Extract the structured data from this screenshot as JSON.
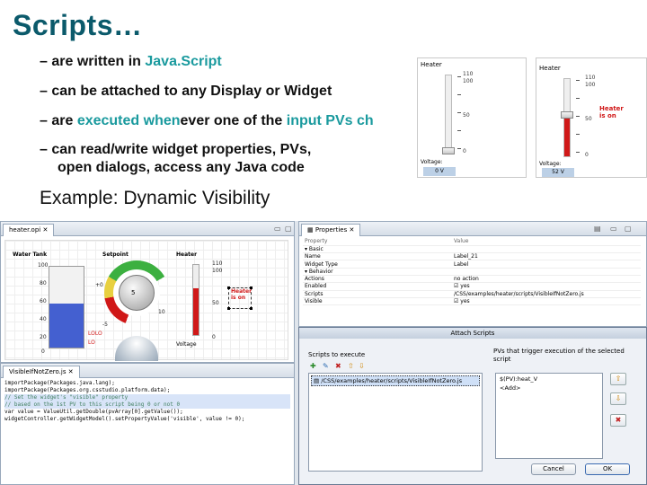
{
  "title": "Scripts…",
  "bullets": [
    {
      "pre": "– are written in ",
      "hl": "Java.Script",
      "mid": "",
      "hl2": "",
      "post": ""
    },
    {
      "pre": "– can be attached to any Display or Widget",
      "hl": "",
      "mid": "",
      "hl2": "",
      "post": ""
    },
    {
      "pre": "– are ",
      "hl": "executed when",
      "mid": "ever one of the ",
      "hl2": "input PVs ch",
      "post": ""
    },
    {
      "pre": "– can read/write widget properties, PVs,",
      "hl": "",
      "mid": "",
      "hl2": "",
      "post": ""
    },
    {
      "pre": "open dialogs, access any Java code",
      "hl": "",
      "mid": "",
      "hl2": "",
      "post": ""
    }
  ],
  "subtitle": "Example: Dynamic Visibility",
  "mini_widgets": [
    {
      "title": "Heater",
      "level": 0.0,
      "voltage_label": "Voltage:",
      "voltage_value": "0 V",
      "ticks": [
        "110",
        "100",
        "50",
        "0"
      ],
      "status": ""
    },
    {
      "title": "Heater",
      "level": 0.55,
      "voltage_label": "Voltage:",
      "voltage_value": "52 V",
      "ticks": [
        "110",
        "100",
        "50",
        "0"
      ],
      "status": "Heater is on"
    }
  ],
  "editor": {
    "tab": "heater.opi",
    "tab_close": "✕",
    "widgets": {
      "tank_label": "Water Tank",
      "tank_ticks": [
        "100",
        "80",
        "60",
        "40",
        "20",
        "0"
      ],
      "tank_level": 0.55,
      "tank_markers": [
        "LOLO",
        "LO"
      ],
      "setpoint_label": "Setpoint",
      "setpoint_value": "5",
      "setpoint_ticks": [
        "+0",
        "-5",
        "10"
      ],
      "heater_label": "Heater",
      "heater_ticks": [
        "110",
        "100",
        "50",
        "0"
      ],
      "heater_status": "Heater is on",
      "voltage_label": "Voltage"
    }
  },
  "script_editor": {
    "tab": "VisibleIfNotZero.js",
    "lines": [
      {
        "text": "importPackage(Packages.java.lang);",
        "comment": false
      },
      {
        "text": "importPackage(Packages.org.csstudio.platform.data);",
        "comment": false
      },
      {
        "text": "",
        "comment": false
      },
      {
        "text": "// Set the widget's \"visible\" property",
        "comment": true
      },
      {
        "text": "// based on the 1st PV to this script being 0 or not 0",
        "comment": true
      },
      {
        "text": "var value = ValueUtil.getDouble(pvArray[0].getValue());",
        "comment": false
      },
      {
        "text": "widgetController.getWidgetModel().setPropertyValue('visible', value != 0);",
        "comment": false
      }
    ]
  },
  "properties": {
    "tab": "Properties",
    "header": [
      "Property",
      "Value"
    ],
    "rows": [
      {
        "name": "▾ Basic",
        "value": ""
      },
      {
        "name": "    Name",
        "value": "Label_21"
      },
      {
        "name": "    Widget Type",
        "value": "Label"
      },
      {
        "name": "▾ Behavior",
        "value": ""
      },
      {
        "name": "    Actions",
        "value": "no action"
      },
      {
        "name": "    Enabled",
        "value": "☑ yes"
      },
      {
        "name": "    Scripts",
        "value": "/CSS/examples/heater/scripts/VisibleIfNotZero.js"
      },
      {
        "name": "    Visible",
        "value": "☑ yes"
      }
    ]
  },
  "dialog": {
    "title": "Attach Scripts",
    "scripts_title": "Scripts to execute",
    "script_item": "/CSS/examples/heater/scripts/VisibleIfNotZero.js",
    "pvs_title": "PVs that trigger execution of the selected script",
    "pv_items": [
      "$(PV):heat_V",
      "<Add>"
    ],
    "cancel_label": "Cancel",
    "ok_label": "OK"
  }
}
